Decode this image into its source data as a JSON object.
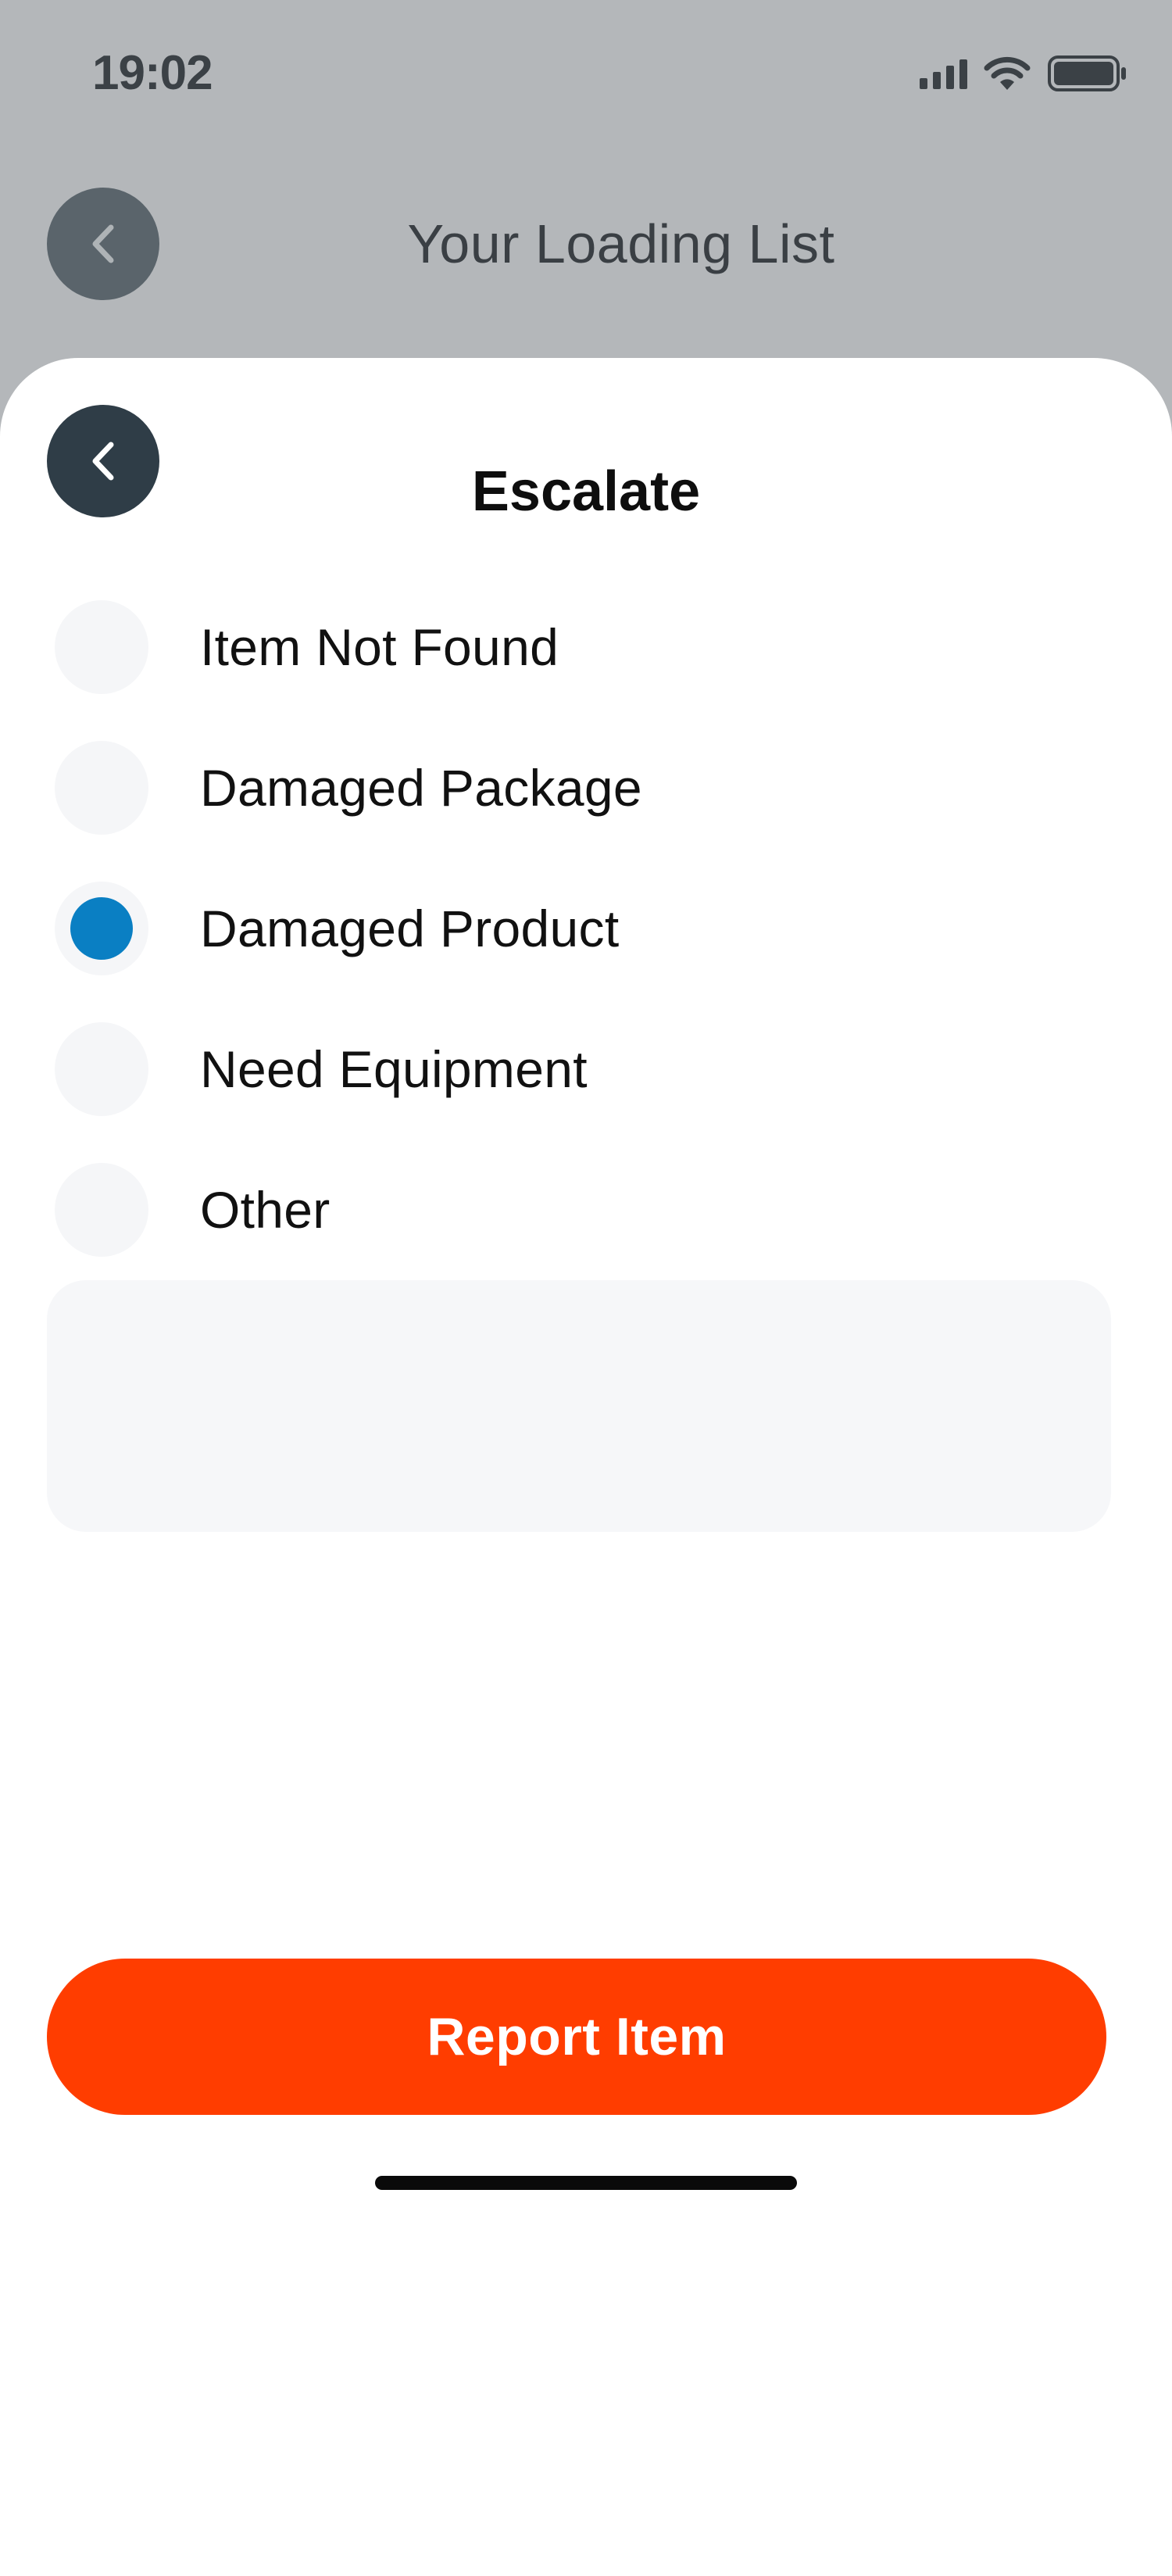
{
  "status_bar": {
    "time": "19:02",
    "icons": [
      "signal-icon",
      "wifi-icon",
      "battery-icon"
    ]
  },
  "background_header": {
    "title": "Your Loading List",
    "back_icon": "chevron-left-icon"
  },
  "sheet": {
    "title": "Escalate",
    "back_icon": "chevron-left-icon",
    "options": [
      {
        "label": "Item Not Found",
        "selected": false
      },
      {
        "label": "Damaged Package",
        "selected": false
      },
      {
        "label": "Damaged Product",
        "selected": true
      },
      {
        "label": "Need Equipment",
        "selected": false
      },
      {
        "label": "Other",
        "selected": false
      }
    ],
    "note": {
      "value": "",
      "placeholder": ""
    },
    "submit_label": "Report Item"
  },
  "colors": {
    "accent": "#ff3d00",
    "radio_selected": "#0a7fc3",
    "back_button_dark": "#2f3d47",
    "overlay_background": "#b4b7ba"
  }
}
